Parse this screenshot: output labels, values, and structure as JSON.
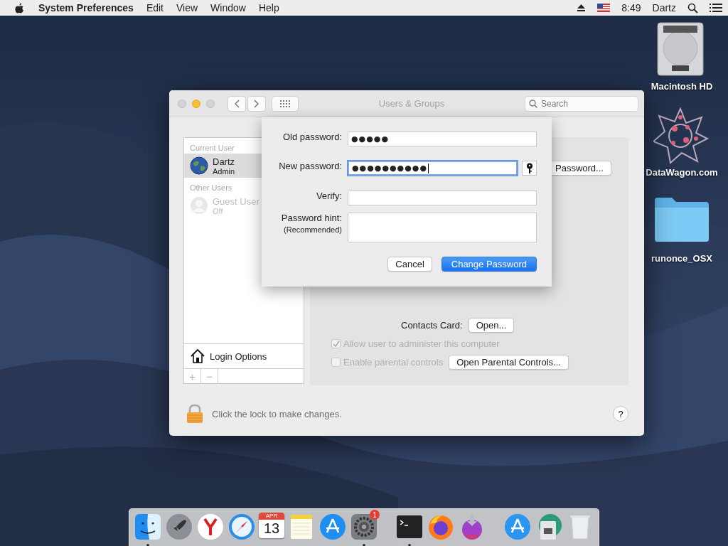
{
  "menu_bar": {
    "app": "System Preferences",
    "items": [
      "Edit",
      "View",
      "Window",
      "Help"
    ],
    "clock": "8:49",
    "user": "Dartz"
  },
  "desktop_icons": [
    {
      "label": "Macintosh HD",
      "kind": "disk"
    },
    {
      "label": "DataWagon.com",
      "kind": "star"
    },
    {
      "label": "runonce_OSX",
      "kind": "folder"
    }
  ],
  "window": {
    "title": "Users & Groups",
    "search": {
      "placeholder": "Search"
    },
    "sidebar": {
      "sections": [
        {
          "heading": "Current User",
          "users": [
            {
              "name": "Dartz",
              "role": "Admin",
              "selected": true,
              "disabled": false,
              "kind": "globe"
            }
          ]
        },
        {
          "heading": "Other Users",
          "users": [
            {
              "name": "Guest User",
              "role": "Off",
              "selected": false,
              "disabled": true,
              "kind": "silhouette"
            }
          ]
        }
      ],
      "login_options": "Login Options",
      "add": "+",
      "remove": "−"
    },
    "panel": {
      "password_button": "Password...",
      "contacts_label": "Contacts Card:",
      "open_button": "Open...",
      "checkboxes": [
        {
          "label": "Allow user to administer this computer",
          "checked": true,
          "disabled": true
        },
        {
          "label": "Enable parental controls",
          "checked": false,
          "disabled": true
        }
      ],
      "parental_button": "Open Parental Controls..."
    },
    "lock_text": "Click the lock to make changes.",
    "help": "?"
  },
  "sheet": {
    "fields": [
      {
        "label": "Old password:",
        "value": "●●●●●",
        "focused": false,
        "kind": "line"
      },
      {
        "label": "New password:",
        "value": "●●●●●●●●●●",
        "focused": true,
        "kind": "key"
      },
      {
        "label": "Verify:",
        "focused": false,
        "kind": "line"
      },
      {
        "label": "Password hint:",
        "sublabel": "(Recommended)",
        "focused": false,
        "kind": "area"
      }
    ],
    "cancel": "Cancel",
    "confirm": "Change Password"
  },
  "dock": {
    "items": [
      {
        "kind": "app",
        "running": true
      },
      {
        "kind": "app",
        "running": false
      },
      {
        "kind": "app",
        "running": false
      },
      {
        "kind": "app",
        "running": false
      },
      {
        "kind": "calendar",
        "running": false,
        "month": "APR",
        "day": "13"
      },
      {
        "kind": "app",
        "running": false
      },
      {
        "kind": "app",
        "running": false
      },
      {
        "kind": "app",
        "running": true,
        "badge": "1"
      },
      {
        "kind": "separator"
      },
      {
        "kind": "app",
        "running": true
      },
      {
        "kind": "app",
        "running": false
      },
      {
        "kind": "app",
        "running": false
      },
      {
        "kind": "separator"
      },
      {
        "kind": "app",
        "running": false
      },
      {
        "kind": "app",
        "running": false
      },
      {
        "kind": "app",
        "running": false
      }
    ]
  }
}
